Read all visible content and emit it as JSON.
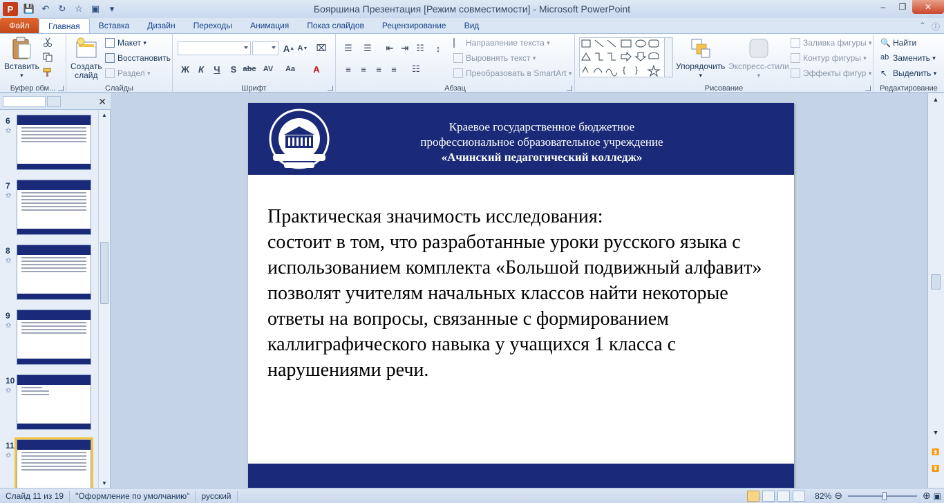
{
  "window": {
    "title": "Бояршина Презентация [Режим совместимости]  -  Microsoft PowerPoint",
    "app_icon": "P"
  },
  "tabs": [
    {
      "label": "Файл"
    },
    {
      "label": "Главная"
    },
    {
      "label": "Вставка"
    },
    {
      "label": "Дизайн"
    },
    {
      "label": "Переходы"
    },
    {
      "label": "Анимация"
    },
    {
      "label": "Показ слайдов"
    },
    {
      "label": "Рецензирование"
    },
    {
      "label": "Вид"
    }
  ],
  "ribbon": {
    "clipboard": {
      "label": "Буфер обм...",
      "paste": "Вставить"
    },
    "slides": {
      "label": "Слайды",
      "create_line1": "Создать",
      "create_line2": "слайд",
      "layout": "Макет",
      "reset": "Восстановить",
      "section": "Раздел"
    },
    "font": {
      "label": "Шрифт"
    },
    "paragraph": {
      "label": "Абзац",
      "text_direction": "Направление текста",
      "align_text": "Выровнять текст",
      "smartart": "Преобразовать в SmartArt"
    },
    "drawing": {
      "label": "Рисование",
      "arrange": "Упорядочить",
      "quick_styles": "Экспресс-стили",
      "shape_fill": "Заливка фигуры",
      "shape_outline": "Контур фигуры",
      "shape_effects": "Эффекты фигур"
    },
    "editing": {
      "label": "Редактирование",
      "find": "Найти",
      "replace": "Заменить",
      "select": "Выделить"
    }
  },
  "thumbnails": [
    {
      "num": "6"
    },
    {
      "num": "7"
    },
    {
      "num": "8"
    },
    {
      "num": "9"
    },
    {
      "num": "10"
    },
    {
      "num": "11"
    }
  ],
  "slide": {
    "header_line1": "Краевое государственное бюджетное",
    "header_line2": "профессиональное образовательное учреждение",
    "header_line3": "«Ачинский педагогический колледж»",
    "body_title": "Практическая значимость исследования:",
    "body_text": "состоит в том, что разработанные уроки русского языка с использованием комплекта «Большой подвижный алфавит» позволят учителям начальных классов найти некоторые ответы на вопросы, связанные с формированием каллиграфического навыка у учащихся 1 класса с нарушениями речи."
  },
  "status": {
    "slide_counter": "Слайд 11 из 19",
    "theme": "\"Оформление по умолчанию\"",
    "language": "русский",
    "zoom": "82%"
  },
  "colors": {
    "slide_band": "#1b2a78",
    "file_tab": "#c14a1a",
    "selected_thumb": "#f5c342"
  }
}
